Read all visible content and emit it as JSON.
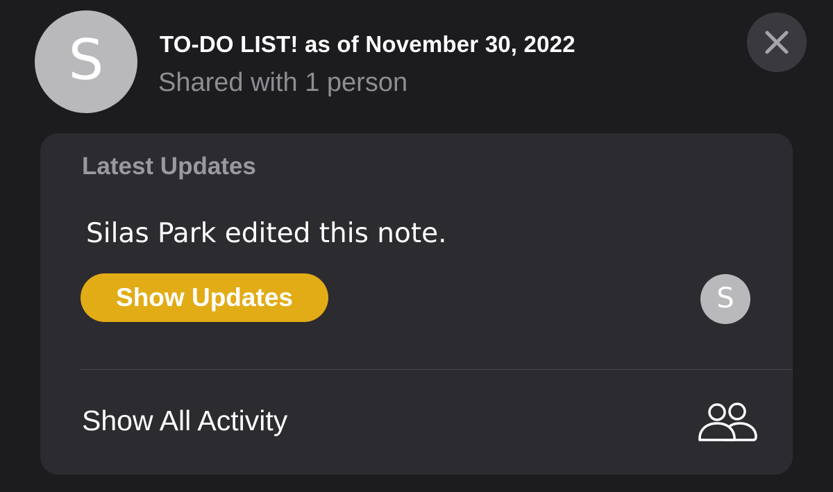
{
  "header": {
    "avatar_initial": "S",
    "title": "TO-DO LIST! as of November 30, 2022",
    "subtitle": "Shared with 1 person",
    "close_icon": "close-icon"
  },
  "updates": {
    "section_label": "Latest Updates",
    "message": "Silas Park edited this note.",
    "show_updates_label": "Show Updates",
    "editor_avatar_initial": "S"
  },
  "activity": {
    "label": "Show All Activity",
    "icon": "people-icon"
  },
  "colors": {
    "background": "#1c1b1e",
    "card": "#2c2b2f",
    "accent": "#e2ac16",
    "avatar": "#b9b9bb",
    "secondary_text": "#8e8d93"
  }
}
